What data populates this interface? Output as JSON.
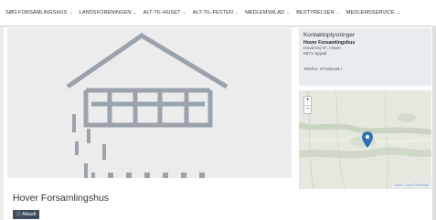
{
  "nav": {
    "items": [
      {
        "label": "SØG FORSAMLINGSHUS",
        "chevron": "⌄"
      },
      {
        "label": "LANDSFORENINGEN",
        "chevron": "⌄"
      },
      {
        "label": "ALT-TIL-HUSET",
        "chevron": "⌄"
      },
      {
        "label": "ALT-TIL-FESTEN",
        "chevron": "⌄"
      },
      {
        "label": "MEDLEMSBLAD",
        "chevron": "⌄"
      },
      {
        "label": "BESTYRELSEN",
        "chevron": "⌄"
      },
      {
        "label": "MEDLEMSSERVICE",
        "chevron": "⌄"
      }
    ]
  },
  "contact": {
    "heading": "Kontaktoplysninger",
    "name": "Hover Forsamlingshus",
    "address_line": "Hovervej 97, Hover",
    "city_line": "6971 Spjald",
    "phone": "Telefon: 97348188 /"
  },
  "map": {
    "zoom_in": "+",
    "zoom_out": "−",
    "attribution": "Leaflet | OpenStreetMap",
    "marker_color": "#2c6fb5"
  },
  "page": {
    "title": "Hover Forsamlingshus",
    "badge": "ⓘ Aktuelt"
  },
  "icons": {
    "hero": "building-placeholder-icon",
    "marker": "map-marker-icon"
  }
}
